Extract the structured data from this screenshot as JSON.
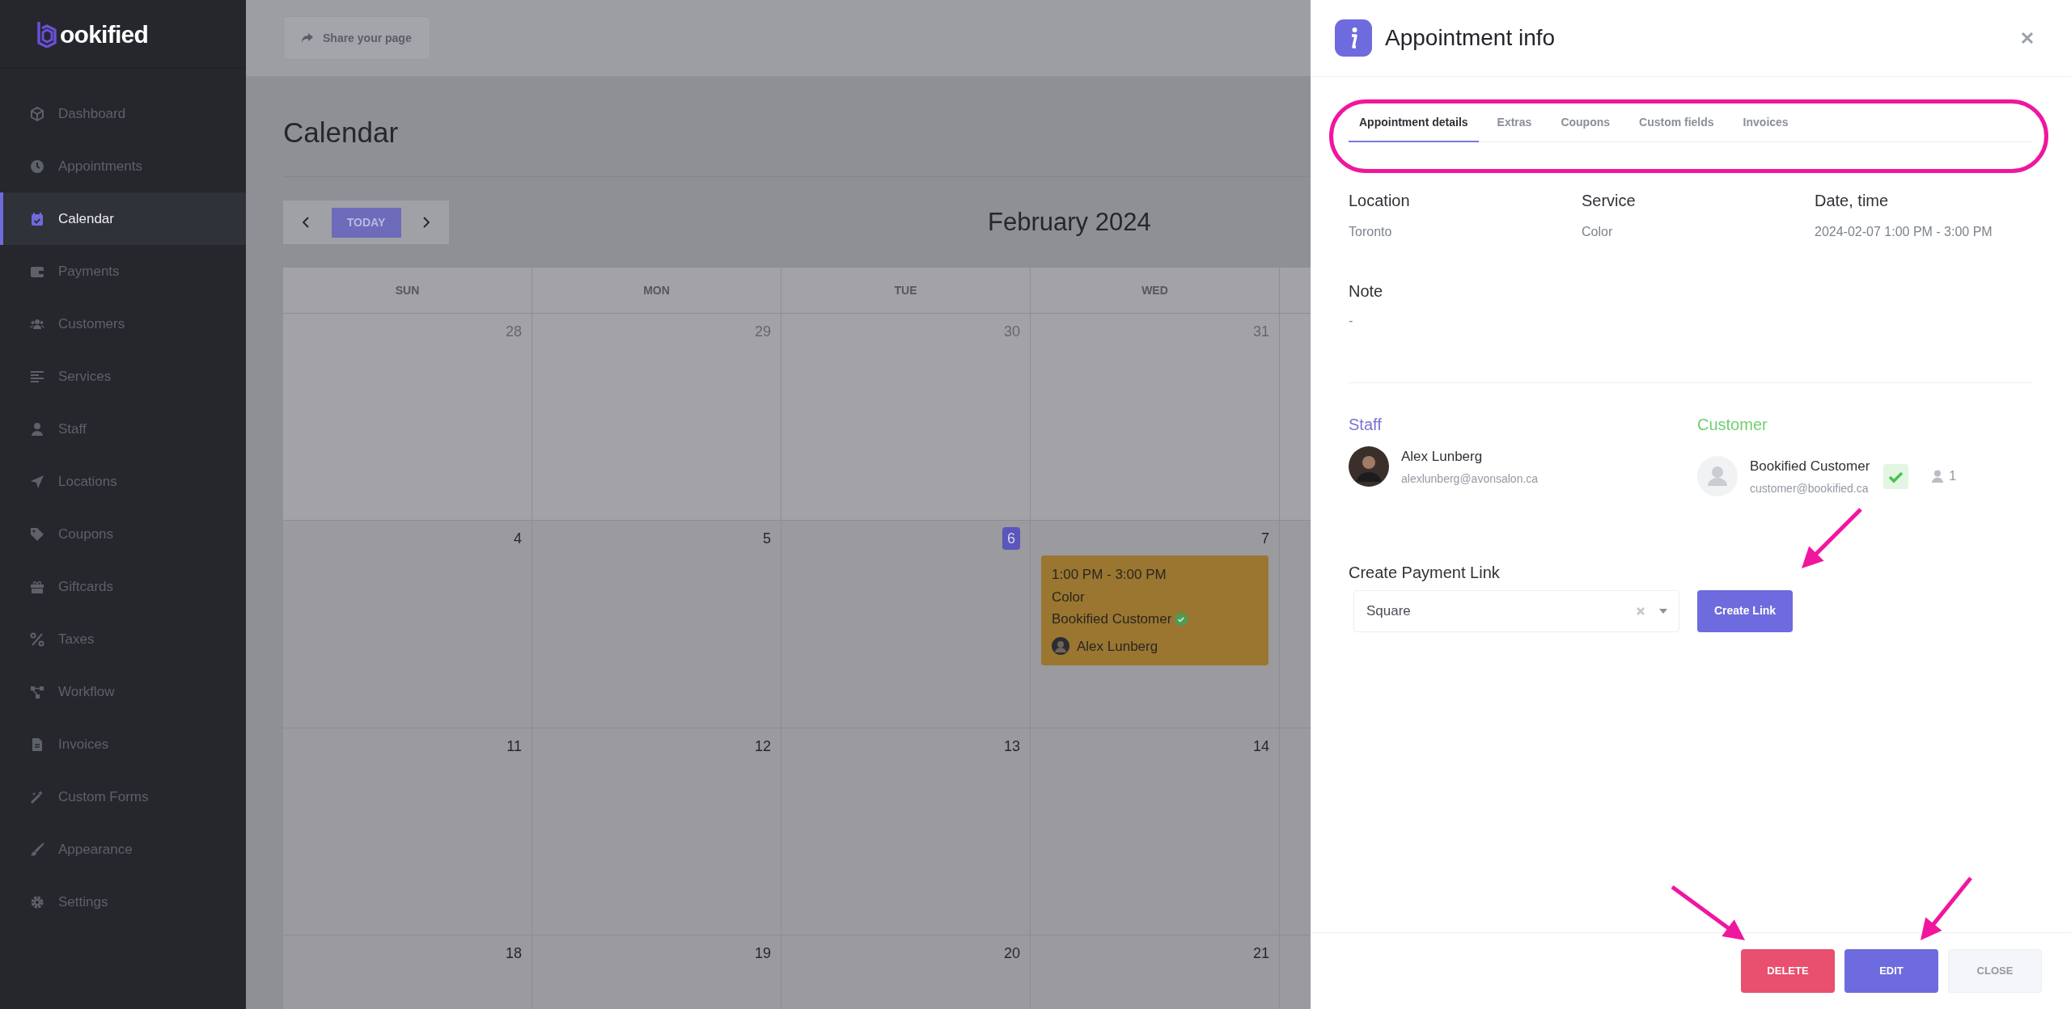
{
  "logo": {
    "text": "ookified"
  },
  "sidebar": {
    "items": [
      {
        "label": "Dashboard",
        "selected": false
      },
      {
        "label": "Appointments",
        "selected": false
      },
      {
        "label": "Calendar",
        "selected": true
      },
      {
        "label": "Payments",
        "selected": false
      },
      {
        "label": "Customers",
        "selected": false
      },
      {
        "label": "Services",
        "selected": false
      },
      {
        "label": "Staff",
        "selected": false
      },
      {
        "label": "Locations",
        "selected": false
      },
      {
        "label": "Coupons",
        "selected": false
      },
      {
        "label": "Giftcards",
        "selected": false
      },
      {
        "label": "Taxes",
        "selected": false
      },
      {
        "label": "Workflow",
        "selected": false
      },
      {
        "label": "Invoices",
        "selected": false
      },
      {
        "label": "Custom Forms",
        "selected": false
      },
      {
        "label": "Appearance",
        "selected": false
      },
      {
        "label": "Settings",
        "selected": false
      }
    ]
  },
  "top_bar": {
    "share_button": "Share your page"
  },
  "calendar": {
    "title": "Calendar",
    "today_button": "TODAY",
    "month": "February 2024",
    "weekdays": [
      "SUN",
      "MON",
      "TUE",
      "WED"
    ],
    "weeks": [
      [
        {
          "day": "28",
          "outside_month": true,
          "today": false
        },
        {
          "day": "29",
          "outside_month": true,
          "today": false
        },
        {
          "day": "30",
          "outside_month": true,
          "today": false
        },
        {
          "day": "31",
          "outside_month": true,
          "today": false
        }
      ],
      [
        {
          "day": "4",
          "outside_month": false,
          "today": false
        },
        {
          "day": "5",
          "outside_month": false,
          "today": false
        },
        {
          "day": "6",
          "outside_month": false,
          "today": true
        },
        {
          "day": "7",
          "outside_month": false,
          "today": false,
          "events": [
            {
              "time": "1:00 PM - 3:00 PM",
              "service": "Color",
              "customer": "Bookified Customer",
              "confirmed": true,
              "staff": "Alex Lunberg"
            }
          ]
        }
      ],
      [
        {
          "day": "11",
          "outside_month": false,
          "today": false
        },
        {
          "day": "12",
          "outside_month": false,
          "today": false
        },
        {
          "day": "13",
          "outside_month": false,
          "today": false
        },
        {
          "day": "14",
          "outside_month": false,
          "today": false
        }
      ],
      [
        {
          "day": "18",
          "outside_month": false,
          "today": false
        },
        {
          "day": "19",
          "outside_month": false,
          "today": false
        },
        {
          "day": "20",
          "outside_month": false,
          "today": false
        },
        {
          "day": "21",
          "outside_month": false,
          "today": false
        }
      ]
    ]
  },
  "panel": {
    "title": "Appointment info",
    "tabs": [
      {
        "label": "Appointment details",
        "selected": true
      },
      {
        "label": "Extras",
        "selected": false
      },
      {
        "label": "Coupons",
        "selected": false
      },
      {
        "label": "Custom fields",
        "selected": false
      },
      {
        "label": "Invoices",
        "selected": false
      }
    ],
    "details": [
      {
        "label": "Location",
        "value": "Toronto"
      },
      {
        "label": "Service",
        "value": "Color"
      },
      {
        "label": "Date, time",
        "value": "2024-02-07 1:00 PM - 3:00 PM"
      }
    ],
    "note": {
      "label": "Note",
      "value": "-"
    },
    "staff": {
      "heading": "Staff",
      "name": "Alex Lunberg",
      "email": "alexlunberg@avonsalon.ca"
    },
    "customer": {
      "heading": "Customer",
      "name": "Bookified Customer",
      "email": "customer@bookified.ca",
      "confirmed": true,
      "count": "1"
    },
    "payment_link": {
      "label": "Create Payment Link",
      "value": "Square",
      "button": "Create Link"
    },
    "footer_buttons": [
      {
        "label": "DELETE",
        "kind": "danger"
      },
      {
        "label": "EDIT",
        "kind": "primary"
      },
      {
        "label": "CLOSE",
        "kind": "secondary"
      }
    ]
  }
}
